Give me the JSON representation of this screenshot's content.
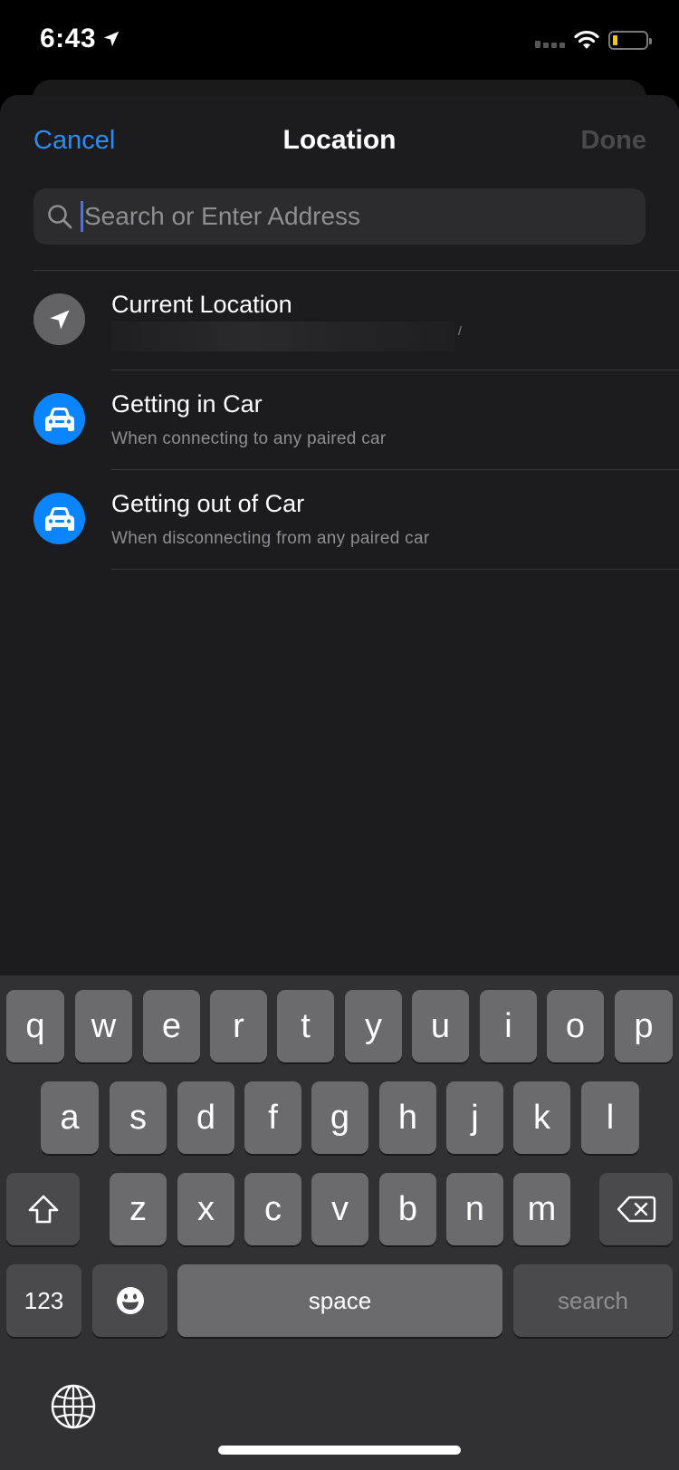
{
  "status_bar": {
    "time": "6:43",
    "location_arrow_icon": "location-arrow-icon",
    "signal_icon": "cellular-signal-icon",
    "wifi_icon": "wifi-icon",
    "battery_icon": "battery-low-icon",
    "battery_color": "#f5c51c"
  },
  "nav": {
    "cancel_label": "Cancel",
    "title": "Location",
    "done_label": "Done"
  },
  "search": {
    "placeholder": "Search or Enter Address",
    "value": "",
    "icon": "search-icon"
  },
  "list": {
    "items": [
      {
        "title": "Current Location",
        "subtitle": "",
        "icon": "location-arrow-icon",
        "icon_bg": "#636366",
        "redacted": true
      },
      {
        "title": "Getting in Car",
        "subtitle": "When connecting to any paired car",
        "icon": "car-icon",
        "icon_bg": "#0a84ff"
      },
      {
        "title": "Getting out of Car",
        "subtitle": "When disconnecting from any paired car",
        "icon": "car-icon",
        "icon_bg": "#0a84ff"
      }
    ]
  },
  "keyboard": {
    "row1": [
      "q",
      "w",
      "e",
      "r",
      "t",
      "y",
      "u",
      "i",
      "o",
      "p"
    ],
    "row2": [
      "a",
      "s",
      "d",
      "f",
      "g",
      "h",
      "j",
      "k",
      "l"
    ],
    "row3": [
      "z",
      "x",
      "c",
      "v",
      "b",
      "n",
      "m"
    ],
    "shift_icon": "shift-icon",
    "delete_icon": "delete-backspace-icon",
    "numbers_label": "123",
    "emoji_icon": "emoji-icon",
    "space_label": "space",
    "search_label": "search",
    "globe_icon": "globe-icon"
  },
  "colors": {
    "accent": "#2f8cf6",
    "sheet_bg": "#1c1c1e",
    "keyboard_bg": "#313133"
  }
}
